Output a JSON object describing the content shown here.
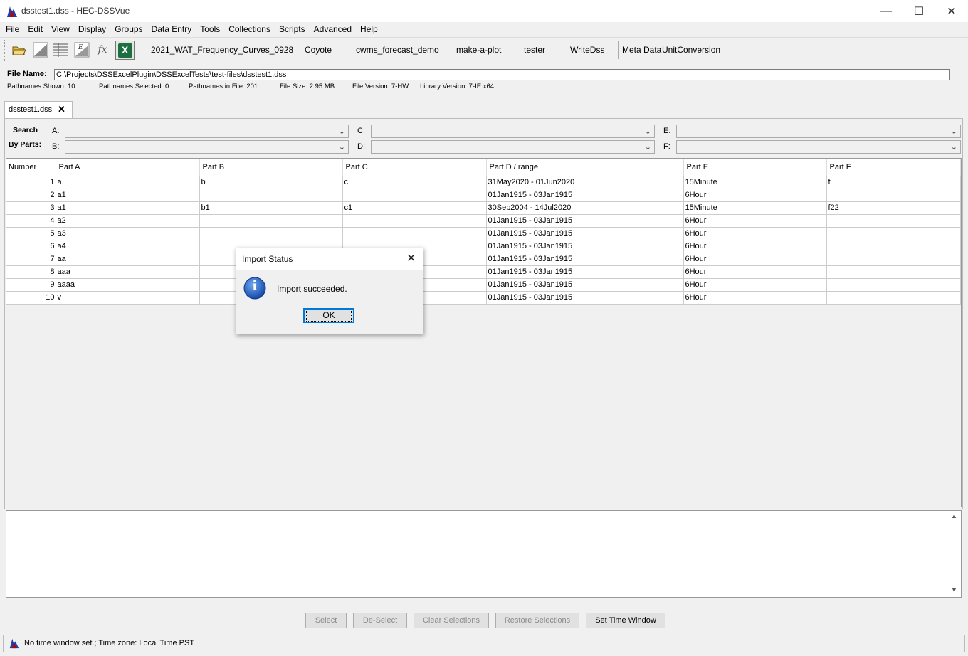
{
  "window": {
    "title": "dsstest1.dss - HEC-DSSVue"
  },
  "menu": [
    "File",
    "Edit",
    "View",
    "Display",
    "Groups",
    "Data Entry",
    "Tools",
    "Collections",
    "Scripts",
    "Advanced",
    "Help"
  ],
  "toolbar": {
    "scripts": [
      "2021_WAT_Frequency_Curves_0928",
      "Coyote",
      "cwms_forecast_demo",
      "make-a-plot",
      "tester",
      "WriteDss"
    ],
    "meta_data": "Meta Data",
    "unit_conversion": "UnitConversion",
    "fx_label": "fx",
    "excel_label": "X"
  },
  "file": {
    "label": "File Name:",
    "path": "C:\\Projects\\DSSExcelPlugin\\DSSExcelTests\\test-files\\dsstest1.dss",
    "info": {
      "shown": "Pathnames Shown:  10",
      "selected": "Pathnames Selected: 0",
      "in_file": "Pathnames in File:  201",
      "size": "File Size:  2.95  MB",
      "version": "File Version: 7-HW",
      "library": "Library Version: 7-IE    x64"
    }
  },
  "tab": {
    "label": "dsstest1.dss",
    "close": "✕"
  },
  "search": {
    "line1": "Search",
    "line2": "By Parts:",
    "parts": {
      "a": "A:",
      "b": "B:",
      "c": "C:",
      "d": "D:",
      "e": "E:",
      "f": "F:"
    }
  },
  "table": {
    "columns": [
      "Number",
      "Part A",
      "Part B",
      "Part C",
      "Part D / range",
      "Part E",
      "Part F"
    ],
    "rows": [
      [
        "1",
        "a",
        "b",
        "c",
        "31May2020 - 01Jun2020",
        "15Minute",
        "f"
      ],
      [
        "2",
        "a1",
        "",
        "",
        "01Jan1915 - 03Jan1915",
        "6Hour",
        ""
      ],
      [
        "3",
        "a1",
        "b1",
        "c1",
        "30Sep2004 - 14Jul2020",
        "15Minute",
        "f22"
      ],
      [
        "4",
        "a2",
        "",
        "",
        "01Jan1915 - 03Jan1915",
        "6Hour",
        ""
      ],
      [
        "5",
        "a3",
        "",
        "",
        "01Jan1915 - 03Jan1915",
        "6Hour",
        ""
      ],
      [
        "6",
        "a4",
        "",
        "",
        "01Jan1915 - 03Jan1915",
        "6Hour",
        ""
      ],
      [
        "7",
        "aa",
        "",
        "",
        "01Jan1915 - 03Jan1915",
        "6Hour",
        ""
      ],
      [
        "8",
        "aaa",
        "",
        "",
        "01Jan1915 - 03Jan1915",
        "6Hour",
        ""
      ],
      [
        "9",
        "aaaa",
        "",
        "",
        "01Jan1915 - 03Jan1915",
        "6Hour",
        ""
      ],
      [
        "10",
        "v",
        "",
        "",
        "01Jan1915 - 03Jan1915",
        "6Hour",
        ""
      ]
    ]
  },
  "buttons": {
    "select": "Select",
    "deselect": "De-Select",
    "clear": "Clear Selections",
    "restore": "Restore Selections",
    "time_window": "Set Time Window"
  },
  "status": {
    "text": "No time window set.;  Time zone: Local Time PST"
  },
  "dialog": {
    "title": "Import Status",
    "message": "Import succeeded.",
    "ok": "OK",
    "info_glyph": "i"
  },
  "colors": {
    "accent": "#0078d7",
    "logo_red": "#c00000",
    "logo_blue": "#1a3fa8",
    "excel_green": "#1d6f42"
  }
}
